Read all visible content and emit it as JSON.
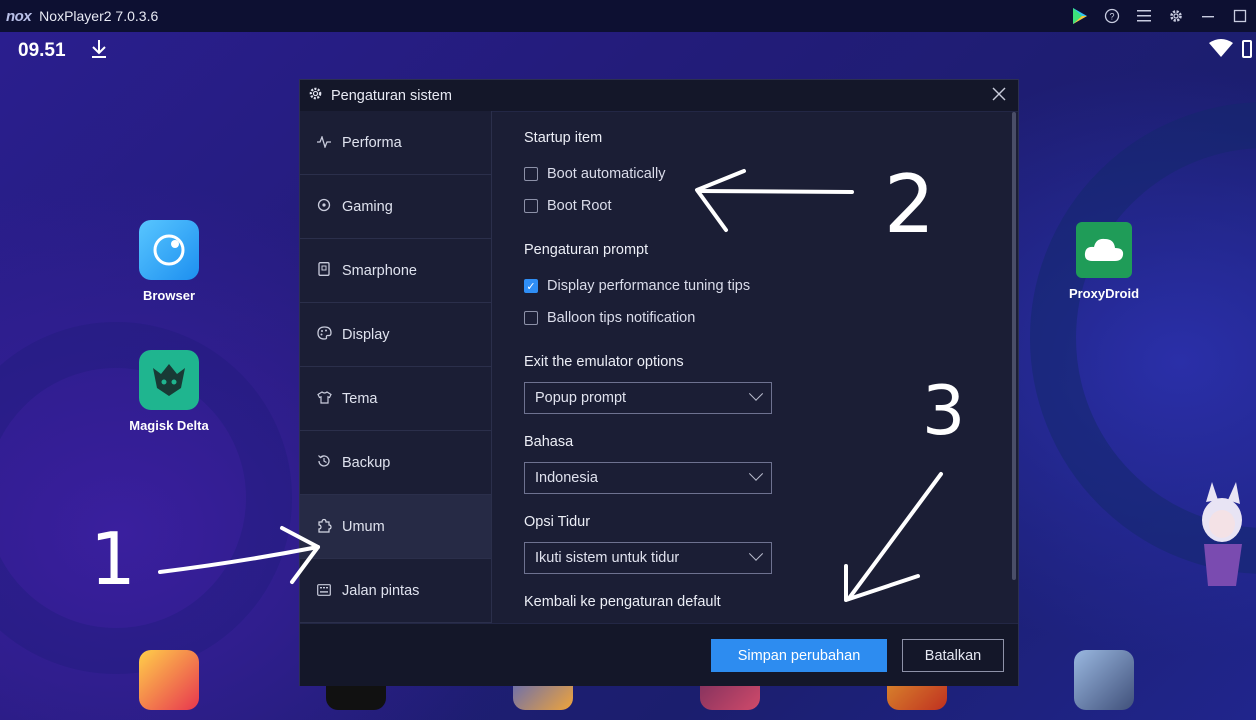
{
  "window": {
    "logo": "nox",
    "title": "NoxPlayer2 7.0.3.6",
    "controls": [
      "play-store-icon",
      "help-icon",
      "menu-icon",
      "settings-icon",
      "minimize-icon",
      "maximize-icon"
    ]
  },
  "statusbar": {
    "time": "09.51"
  },
  "desktop_apps": {
    "browser": "Browser",
    "magisk": "Magisk Delta",
    "proxydroid": "ProxyDroid"
  },
  "annotations": {
    "one": "1",
    "two": "2",
    "three": "3"
  },
  "dialog": {
    "title": "Pengaturan sistem",
    "sidebar": [
      {
        "label": "Performa",
        "icon": "pulse-icon"
      },
      {
        "label": "Gaming",
        "icon": "gamepad-icon"
      },
      {
        "label": "Smarphone",
        "icon": "phone-icon"
      },
      {
        "label": "Display",
        "icon": "palette-icon"
      },
      {
        "label": "Tema",
        "icon": "shirt-icon"
      },
      {
        "label": "Backup",
        "icon": "history-icon"
      },
      {
        "label": "Umum",
        "icon": "puzzle-icon"
      },
      {
        "label": "Jalan pintas",
        "icon": "keyboard-icon"
      }
    ],
    "sections": {
      "startup": "Startup item",
      "boot_auto": "Boot automatically",
      "boot_root": "Boot Root",
      "prompt": "Pengaturan prompt",
      "perf_tips": "Display performance tuning tips",
      "balloon": "Balloon tips notification",
      "exit_label": "Exit the emulator options",
      "exit_value": "Popup prompt",
      "lang_label": "Bahasa",
      "lang_value": "Indonesia",
      "sleep_label": "Opsi Tidur",
      "sleep_value": "Ikuti sistem untuk tidur",
      "reset": "Kembali ke pengaturan default"
    },
    "checkbox_states": {
      "boot_auto": false,
      "boot_root": false,
      "perf_tips": true,
      "balloon": false
    },
    "save_button": "Simpan perubahan",
    "cancel_button": "Batalkan"
  },
  "colors": {
    "accent": "#2d8cf0",
    "dialog_bg": "#1b1e35",
    "titlebar_bg": "#0d1032"
  }
}
